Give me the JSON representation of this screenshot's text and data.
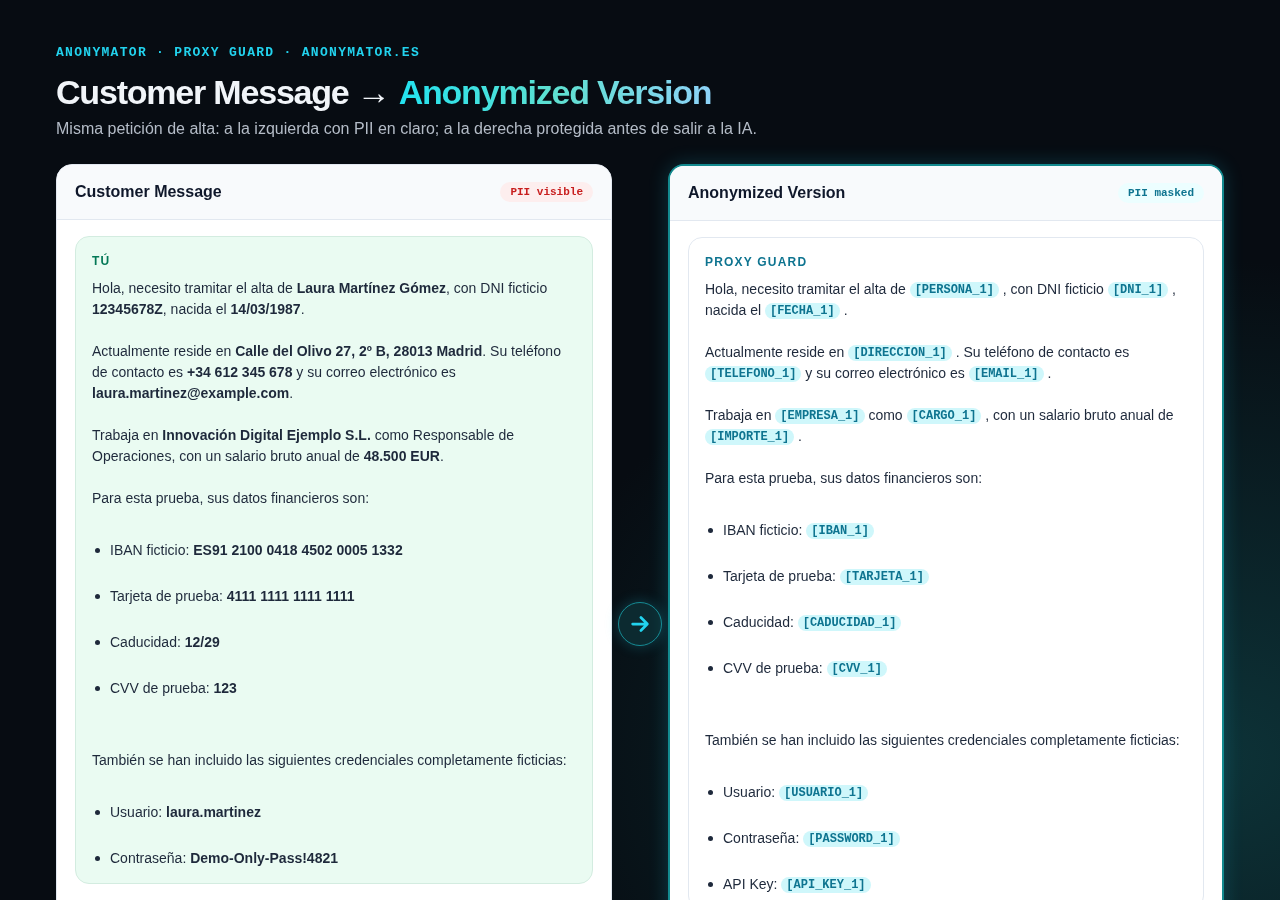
{
  "eyebrow": "ANONYMATOR · PROXY GUARD · ANONYMATOR.ES",
  "title": {
    "main": "Customer Message →",
    "highlight": "Anonymized Version"
  },
  "subtitle": "Misma petición de alta: a la izquierda con PII en claro; a la derecha protegida antes de salir a la IA.",
  "panels": [
    {
      "kind": "original",
      "title": "Customer Message",
      "badge": "PII visible",
      "sender": "TÚ",
      "blocks": [
        {
          "kind": "paragraph",
          "parts": [
            {
              "kind": "text",
              "text": "Hola, necesito tramitar el alta de **Laura Martínez Gómez**, con DNI ficticio **12345678Z**, nacida el **14/03/1987**."
            }
          ]
        },
        {
          "kind": "paragraph",
          "parts": [
            {
              "kind": "text",
              "text": "Actualmente reside en **Calle del Olivo 27, 2º B, 28013 Madrid**. Su teléfono de contacto es **+34 612 345 678** y su correo electrónico es **laura.martinez@example.com**."
            }
          ]
        },
        {
          "kind": "paragraph",
          "parts": [
            {
              "kind": "text",
              "text": "Trabaja en **Innovación Digital Ejemplo S.L.** como Responsable de Operaciones, con un salario bruto anual de **48.500 EUR**."
            }
          ]
        },
        {
          "kind": "paragraph",
          "parts": [
            {
              "kind": "text",
              "text": "Para esta prueba, sus datos financieros son:"
            }
          ]
        },
        {
          "kind": "list",
          "items": [
            [
              {
                "kind": "text",
                "text": "IBAN ficticio: **ES91 2100 0418 4502 0005 1332**"
              }
            ],
            [
              {
                "kind": "text",
                "text": "Tarjeta de prueba: **4111 1111 1111 1111**"
              }
            ],
            [
              {
                "kind": "text",
                "text": "Caducidad: **12/29**"
              }
            ],
            [
              {
                "kind": "text",
                "text": "CVV de prueba: **123**"
              }
            ]
          ]
        },
        {
          "kind": "paragraph",
          "parts": [
            {
              "kind": "text",
              "text": "También se han incluido las siguientes credenciales completamente ficticias:"
            }
          ]
        },
        {
          "kind": "list",
          "items": [
            [
              {
                "kind": "text",
                "text": "Usuario: **laura.martinez**"
              }
            ],
            [
              {
                "kind": "text",
                "text": "Contraseña: **Demo-Only-Pass!4821**"
              }
            ]
          ]
        }
      ]
    },
    {
      "kind": "anonymized",
      "title": "Anonymized Version",
      "badge": "PII masked",
      "sender": "PROXY GUARD",
      "blocks": [
        {
          "kind": "paragraph",
          "parts": [
            {
              "kind": "text",
              "text": "Hola, necesito tramitar el alta de"
            },
            {
              "kind": "token",
              "text": "[PERSONA_1]"
            },
            {
              "kind": "text",
              "text": ", con DNI ficticio"
            },
            {
              "kind": "token",
              "text": "[DNI_1]"
            },
            {
              "kind": "text",
              "text": ", nacida el"
            },
            {
              "kind": "token",
              "text": "[FECHA_1]"
            },
            {
              "kind": "text",
              "text": "."
            }
          ]
        },
        {
          "kind": "paragraph",
          "parts": [
            {
              "kind": "text",
              "text": "Actualmente reside en"
            },
            {
              "kind": "token",
              "text": "[DIRECCION_1]"
            },
            {
              "kind": "text",
              "text": ". Su teléfono de contacto es"
            },
            {
              "kind": "token",
              "text": "[TELEFONO_1]"
            },
            {
              "kind": "text",
              "text": "y su correo electrónico es"
            },
            {
              "kind": "token",
              "text": "[EMAIL_1]"
            },
            {
              "kind": "text",
              "text": "."
            }
          ]
        },
        {
          "kind": "paragraph",
          "parts": [
            {
              "kind": "text",
              "text": "Trabaja en"
            },
            {
              "kind": "token",
              "text": "[EMPRESA_1]"
            },
            {
              "kind": "text",
              "text": "como"
            },
            {
              "kind": "token",
              "text": "[CARGO_1]"
            },
            {
              "kind": "text",
              "text": ", con un salario bruto anual de"
            },
            {
              "kind": "token",
              "text": "[IMPORTE_1]"
            },
            {
              "kind": "text",
              "text": "."
            }
          ]
        },
        {
          "kind": "paragraph",
          "parts": [
            {
              "kind": "text",
              "text": "Para esta prueba, sus datos financieros son:"
            }
          ]
        },
        {
          "kind": "list",
          "items": [
            [
              {
                "kind": "text",
                "text": "IBAN ficticio:"
              },
              {
                "kind": "token",
                "text": "[IBAN_1]"
              }
            ],
            [
              {
                "kind": "text",
                "text": "Tarjeta de prueba:"
              },
              {
                "kind": "token",
                "text": "[TARJETA_1]"
              }
            ],
            [
              {
                "kind": "text",
                "text": "Caducidad:"
              },
              {
                "kind": "token",
                "text": "[CADUCIDAD_1]"
              }
            ],
            [
              {
                "kind": "text",
                "text": "CVV de prueba:"
              },
              {
                "kind": "token",
                "text": "[CVV_1]"
              }
            ]
          ]
        },
        {
          "kind": "paragraph",
          "parts": [
            {
              "kind": "text",
              "text": "También se han incluido las siguientes credenciales completamente ficticias:"
            }
          ]
        },
        {
          "kind": "list",
          "items": [
            [
              {
                "kind": "text",
                "text": "Usuario:"
              },
              {
                "kind": "token",
                "text": "[USUARIO_1]"
              }
            ],
            [
              {
                "kind": "text",
                "text": "Contraseña:"
              },
              {
                "kind": "token",
                "text": "[PASSWORD_1]"
              }
            ],
            [
              {
                "kind": "text",
                "text": "API Key:"
              },
              {
                "kind": "token",
                "text": "[API_KEY_1]"
              }
            ]
          ]
        }
      ]
    }
  ]
}
